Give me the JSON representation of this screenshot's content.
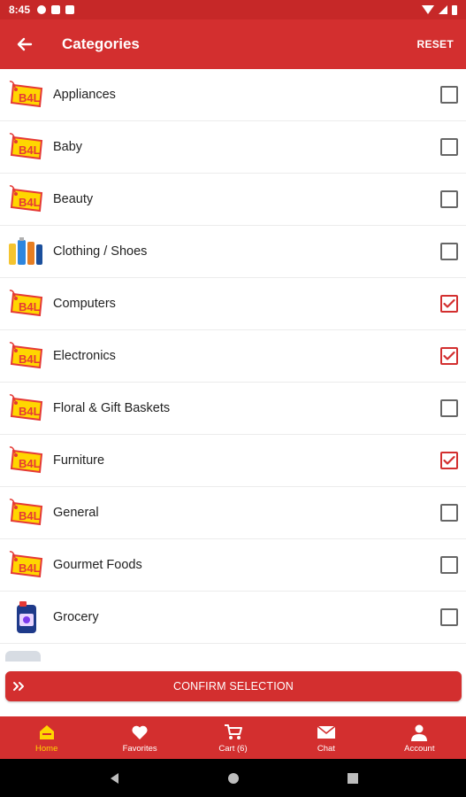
{
  "status_bar": {
    "time": "8:45"
  },
  "app_bar": {
    "title": "Categories",
    "reset_label": "RESET"
  },
  "categories": [
    {
      "label": "Appliances",
      "thumb": "b4l-tag",
      "checked": false
    },
    {
      "label": "Baby",
      "thumb": "b4l-tag",
      "checked": false
    },
    {
      "label": "Beauty",
      "thumb": "b4l-tag",
      "checked": false
    },
    {
      "label": "Clothing / Shoes",
      "thumb": "bottles",
      "checked": false
    },
    {
      "label": "Computers",
      "thumb": "b4l-tag",
      "checked": true
    },
    {
      "label": "Electronics",
      "thumb": "b4l-tag",
      "checked": true
    },
    {
      "label": "Floral & Gift Baskets",
      "thumb": "b4l-tag",
      "checked": false
    },
    {
      "label": "Furniture",
      "thumb": "b4l-tag",
      "checked": true
    },
    {
      "label": "General",
      "thumb": "b4l-tag",
      "checked": false
    },
    {
      "label": "Gourmet Foods",
      "thumb": "b4l-tag",
      "checked": false
    },
    {
      "label": "Grocery",
      "thumb": "detergent",
      "checked": false
    }
  ],
  "confirm": {
    "label": "CONFIRM SELECTION"
  },
  "bottom_nav": [
    {
      "label": "Home",
      "icon": "home-icon",
      "active": true
    },
    {
      "label": "Favorites",
      "icon": "heart-icon",
      "active": false
    },
    {
      "label": "Cart (6)",
      "icon": "cart-icon",
      "active": false
    },
    {
      "label": "Chat",
      "icon": "mail-icon",
      "active": false
    },
    {
      "label": "Account",
      "icon": "person-icon",
      "active": false
    }
  ],
  "colors": {
    "primary": "#d32f2f",
    "status_bar": "#c62828",
    "active_nav": "#ffd600",
    "tag_yellow": "#ffd600"
  }
}
